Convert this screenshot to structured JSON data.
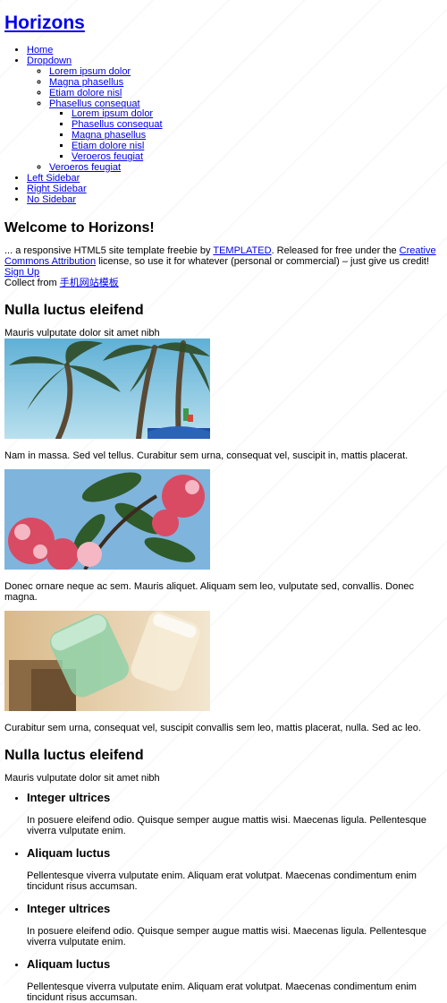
{
  "site": {
    "logo": "Horizons"
  },
  "nav": {
    "home": "Home",
    "dropdown": "Dropdown",
    "dropdown_items": {
      "a": "Lorem ipsum dolor",
      "b": "Magna phasellus",
      "c": "Etiam dolore nisl",
      "d": "Phasellus consequat",
      "sub": {
        "a": "Lorem ipsum dolor",
        "b": "Phasellus consequat",
        "c": "Magna phasellus",
        "d": "Etiam dolore nisl",
        "e": "Veroeros feugiat"
      },
      "e": "Veroeros feugiat"
    },
    "left_sidebar": "Left Sidebar",
    "right_sidebar": "Right Sidebar",
    "no_sidebar": "No Sidebar"
  },
  "welcome": {
    "heading": "Welcome to Horizons!",
    "intro_1": "... a responsive HTML5 site template freebie by ",
    "templated_link": "TEMPLATED",
    "intro_2": ". Released for free under the ",
    "cc_link": "Creative Commons Attribution",
    "intro_3": " license, so use it for whatever (personal or commercial) – just give us credit! ",
    "signup_link": "Sign Up",
    "collect_prefix": "Collect from ",
    "collect_link": "手机网站模板"
  },
  "section1": {
    "heading": "Nulla luctus eleifend",
    "subtitle": "Mauris vulputate dolor sit amet nibh",
    "captions": [
      "Nam in massa. Sed vel tellus. Curabitur sem urna, consequat vel, suscipit in, mattis placerat.",
      "Donec ornare neque ac sem. Mauris aliquet. Aliquam sem leo, vulputate sed, convallis. Donec magna.",
      "Curabitur sem urna, consequat vel, suscipit convallis sem leo, mattis placerat, nulla. Sed ac leo."
    ],
    "images": [
      "palm-trees-image",
      "pink-flowers-image",
      "glass-jars-image"
    ]
  },
  "section2": {
    "heading": "Nulla luctus eleifend",
    "subtitle": "Mauris vulputate dolor sit amet nibh",
    "features": [
      {
        "title": "Integer ultrices",
        "text": "In posuere eleifend odio. Quisque semper augue mattis wisi. Maecenas ligula. Pellentesque viverra vulputate enim."
      },
      {
        "title": "Aliquam luctus",
        "text": "Pellentesque viverra vulputate enim. Aliquam erat volutpat. Maecenas condimentum enim tincidunt risus accumsan."
      },
      {
        "title": "Integer ultrices",
        "text": "In posuere eleifend odio. Quisque semper augue mattis wisi. Maecenas ligula. Pellentesque viverra vulputate enim."
      },
      {
        "title": "Aliquam luctus",
        "text": "Pellentesque viverra vulputate enim. Aliquam erat volutpat. Maecenas condimentum enim tincidunt risus accumsan."
      }
    ]
  }
}
